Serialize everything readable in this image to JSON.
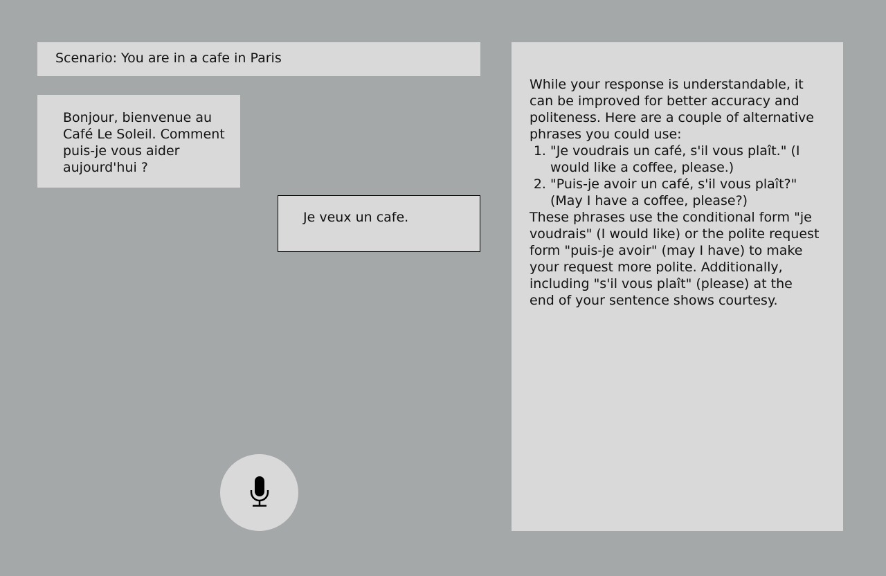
{
  "scenario": {
    "text": "Scenario: You are in a cafe in Paris"
  },
  "conversation": {
    "bot_message": "Bonjour, bienvenue au Café Le Soleil. Comment puis-je vous aider aujourd'hui ?",
    "user_message": "Je veux un cafe."
  },
  "mic": {
    "icon": "microphone-icon"
  },
  "feedback": {
    "intro": "While your response is understandable, it can be improved for better accuracy and politeness. Here are a couple of alternative phrases you could use:",
    "suggestions": [
      "\"Je voudrais un café, s'il vous plaît.\" (I would like a coffee, please.)",
      "\"Puis-je avoir un café, s'il vous plaît?\" (May I have a coffee, please?)"
    ],
    "explanation": "These phrases use the conditional form \"je voudrais\" (I would like) or the polite request form \"puis-je avoir\" (may I have) to make your request more polite. Additionally, including \"s'il vous plaît\" (please) at the end of your sentence shows courtesy."
  }
}
